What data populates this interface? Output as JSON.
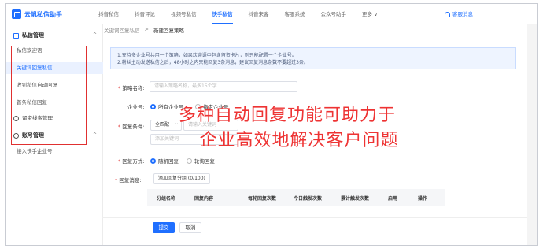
{
  "brand": {
    "name": "云帆私信助手",
    "icon": "chat-logo-icon"
  },
  "nav": {
    "items": [
      "抖音私信",
      "抖音评论",
      "视频号私信",
      "快手私信",
      "抖音来客",
      "客服系统",
      "公众号助手",
      "更多 ∨"
    ],
    "active": "快手私信"
  },
  "notice": "客服消息",
  "sidebar": {
    "group1": "私信管理",
    "items": [
      "私信欢迎语",
      "关键词回复私信",
      "收到私信自动回复",
      "首条私信回复",
      "留资线索管理"
    ],
    "active": "关键词回复私信",
    "group2": "账号管理",
    "items2": [
      "接入快手企业号"
    ]
  },
  "breadcrumb": {
    "parent": "关键词回复私信",
    "sep": ">",
    "current": "新建回复策略"
  },
  "alert": {
    "line1": "1.支持多企业号共用一个策略，如果欢迎语中包含留资卡片，则只能配置一个企业号。",
    "line2": "2.粉丝主动发送私信之后，48小时之内只能回复3条消息，建议回复消息条数不要超过3条。"
  },
  "form": {
    "strategy_label": "策略名称:",
    "strategy_placeholder": "请输入策略名称，最多15个字",
    "account_label": "企业号:",
    "account_option": "所有企业号",
    "account_option2": "指定企业号",
    "condition_label": "回复条件:",
    "match_select": "全匹配",
    "keyword_placeholder": "请输入关键词",
    "keyword_hint": "添加关键词",
    "method_label": "回复方式:",
    "method_random": "随机回复",
    "method_poll": "轮询回复",
    "message_label": "回复消息:",
    "add_group": "添加回复分组 (0/100)"
  },
  "table": {
    "headers": [
      "分组名称",
      "回复内容",
      "每轮回复次数",
      "今日触发次数",
      "累计触发次数",
      "启用",
      "操作"
    ]
  },
  "buttons": {
    "submit": "提交",
    "cancel": "取消"
  },
  "overlay": {
    "line1": "多种自动回复功能可助力于",
    "line2": "企业高效地解决客户问题"
  },
  "colors": {
    "accent": "#1f6fff",
    "highlight": "#e03030",
    "overlay_text": "#e33333"
  }
}
